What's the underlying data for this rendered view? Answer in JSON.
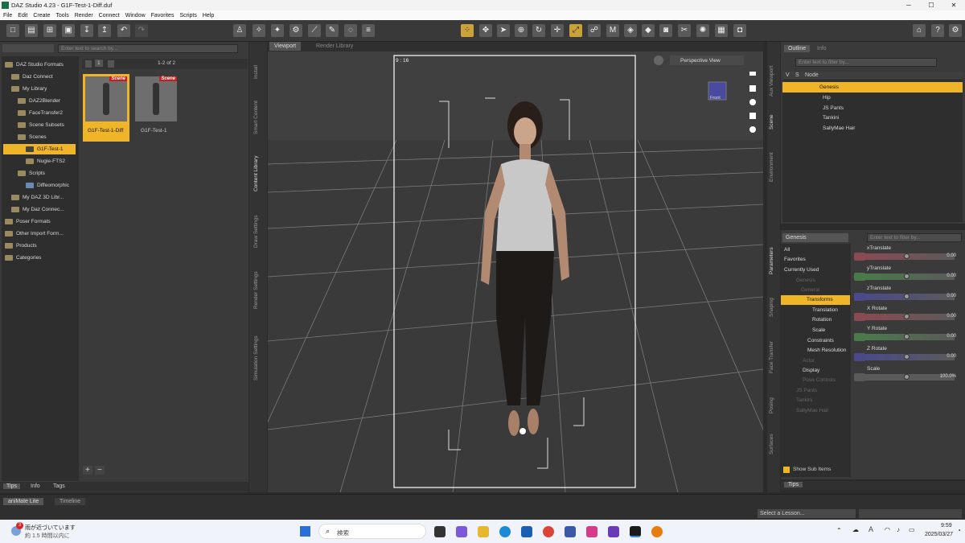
{
  "window": {
    "title": "DAZ Studio 4.23 - G1F-Test-1-Diff.duf",
    "min": "─",
    "max": "☐",
    "close": "✕"
  },
  "menu": [
    "File",
    "Edit",
    "Create",
    "Tools",
    "Render",
    "Connect",
    "Window",
    "Favorites",
    "Scripts",
    "Help"
  ],
  "content_library": {
    "search_placeholder": "Enter text to search by...",
    "page_label": "1",
    "count": "1-2 of 2",
    "tree": [
      {
        "label": "DAZ Studio Formats",
        "indent": 0
      },
      {
        "label": "Daz Connect",
        "indent": 1
      },
      {
        "label": "My Library",
        "indent": 1
      },
      {
        "label": "DAZ2Blender",
        "indent": 2
      },
      {
        "label": "FaceTransfer2",
        "indent": 2
      },
      {
        "label": "Scene Subsets",
        "indent": 2
      },
      {
        "label": "Scenes",
        "indent": 2
      },
      {
        "label": "G1F-Test-1",
        "indent": 3
      },
      {
        "label": "Nugie-FTS2",
        "indent": 3
      },
      {
        "label": "Scripts",
        "indent": 2
      },
      {
        "label": "Diffeomorphic",
        "indent": 3
      },
      {
        "label": "My DAZ 3D Libr...",
        "indent": 1
      },
      {
        "label": "My Daz Connec...",
        "indent": 1
      },
      {
        "label": "Poser Formats",
        "indent": 0
      },
      {
        "label": "Other Import Form...",
        "indent": 0
      },
      {
        "label": "Products",
        "indent": 0
      },
      {
        "label": "Categories",
        "indent": 0
      }
    ],
    "thumbs": [
      {
        "label": "G1F-Test-1-Diff",
        "badge": "Scene"
      },
      {
        "label": "G1F-Test-1",
        "badge": "Scene"
      }
    ],
    "add": "+",
    "remove": "−"
  },
  "bottom_tabs": [
    "Tips",
    "Info",
    "Tags"
  ],
  "side_tabs_left": [
    "Install",
    "Smart Content",
    "Content Library",
    "Draw Settings",
    "Render Settings",
    "Simulation Settings"
  ],
  "viewport": {
    "tabs": [
      "Viewport",
      "Render Library"
    ],
    "aspect": "9 : 16",
    "view_select": "Perspective View",
    "cube_label": "Front"
  },
  "outline": {
    "tabs": [
      "Outline",
      "Info"
    ],
    "filter_placeholder": "Enter text to filter by...",
    "col_v": "V",
    "col_s": "S",
    "col_node": "Node",
    "nodes": [
      {
        "label": "Genesis",
        "indent": 0
      },
      {
        "label": "Hip",
        "indent": 1
      },
      {
        "label": "JS Pants",
        "indent": 1
      },
      {
        "label": "Tankini",
        "indent": 1
      },
      {
        "label": "SallyMae Hair",
        "indent": 1
      }
    ]
  },
  "side_tabs_right_top": [
    "Aux Viewport",
    "Scene",
    "Environment"
  ],
  "side_tabs_right_bottom": [
    "Parameters",
    "Shaping",
    "Face Transfer",
    "Posing",
    "Surfaces"
  ],
  "parameters": {
    "node_select": "Genesis",
    "filter_placeholder": "Enter text to filter by...",
    "tree": [
      {
        "label": "All",
        "kind": "cat"
      },
      {
        "label": "Favorites",
        "kind": "cat"
      },
      {
        "label": "Currently Used",
        "kind": "cat"
      },
      {
        "label": "Genesis",
        "kind": "dim",
        "indent": 0
      },
      {
        "label": "General",
        "kind": "dim",
        "indent": 1
      },
      {
        "label": "Transforms",
        "kind": "sel",
        "indent": 2
      },
      {
        "label": "Translation",
        "kind": "item",
        "indent": 3
      },
      {
        "label": "Rotation",
        "kind": "item",
        "indent": 3
      },
      {
        "label": "Scale",
        "kind": "item",
        "indent": 3
      },
      {
        "label": "Constraints",
        "kind": "item",
        "indent": 2
      },
      {
        "label": "Mesh Resolution",
        "kind": "item",
        "indent": 2
      },
      {
        "label": "Actor",
        "kind": "dim",
        "indent": 1
      },
      {
        "label": "Display",
        "kind": "item",
        "indent": 1
      },
      {
        "label": "Pose Controls",
        "kind": "dim",
        "indent": 1
      },
      {
        "label": "JS Pants",
        "kind": "dim",
        "indent": 0
      },
      {
        "label": "Tankini",
        "kind": "dim",
        "indent": 0
      },
      {
        "label": "SallyMae Hair",
        "kind": "dim",
        "indent": 0
      }
    ],
    "show_sub_items": "Show Sub Items",
    "props": [
      {
        "label": "xTranslate",
        "value": "0.00",
        "color": "#8a4a52"
      },
      {
        "label": "yTranslate",
        "value": "0.00",
        "color": "#4a7a4a"
      },
      {
        "label": "zTranslate",
        "value": "0.00",
        "color": "#4a4a8a"
      },
      {
        "label": "X Rotate",
        "value": "0.00",
        "color": "#8a4a52"
      },
      {
        "label": "Y Rotate",
        "value": "0.00",
        "color": "#4a7a4a"
      },
      {
        "label": "Z Rotate",
        "value": "0.00",
        "color": "#4a4a8a"
      },
      {
        "label": "Scale",
        "value": "100.0%",
        "color": "#5a5a5a"
      }
    ]
  },
  "tips_tab": "Tips",
  "timeline": {
    "tabs": [
      "aniMate Lite",
      "Timeline"
    ],
    "lesson": "Select a Lesson..."
  },
  "taskbar": {
    "weather_badge": "3",
    "weather_line1": "雨が近づいています",
    "weather_line2": "約 1.5 時間以内に",
    "search": "検索",
    "time": "9:59",
    "date": "2025/03/27",
    "ime": "A"
  }
}
